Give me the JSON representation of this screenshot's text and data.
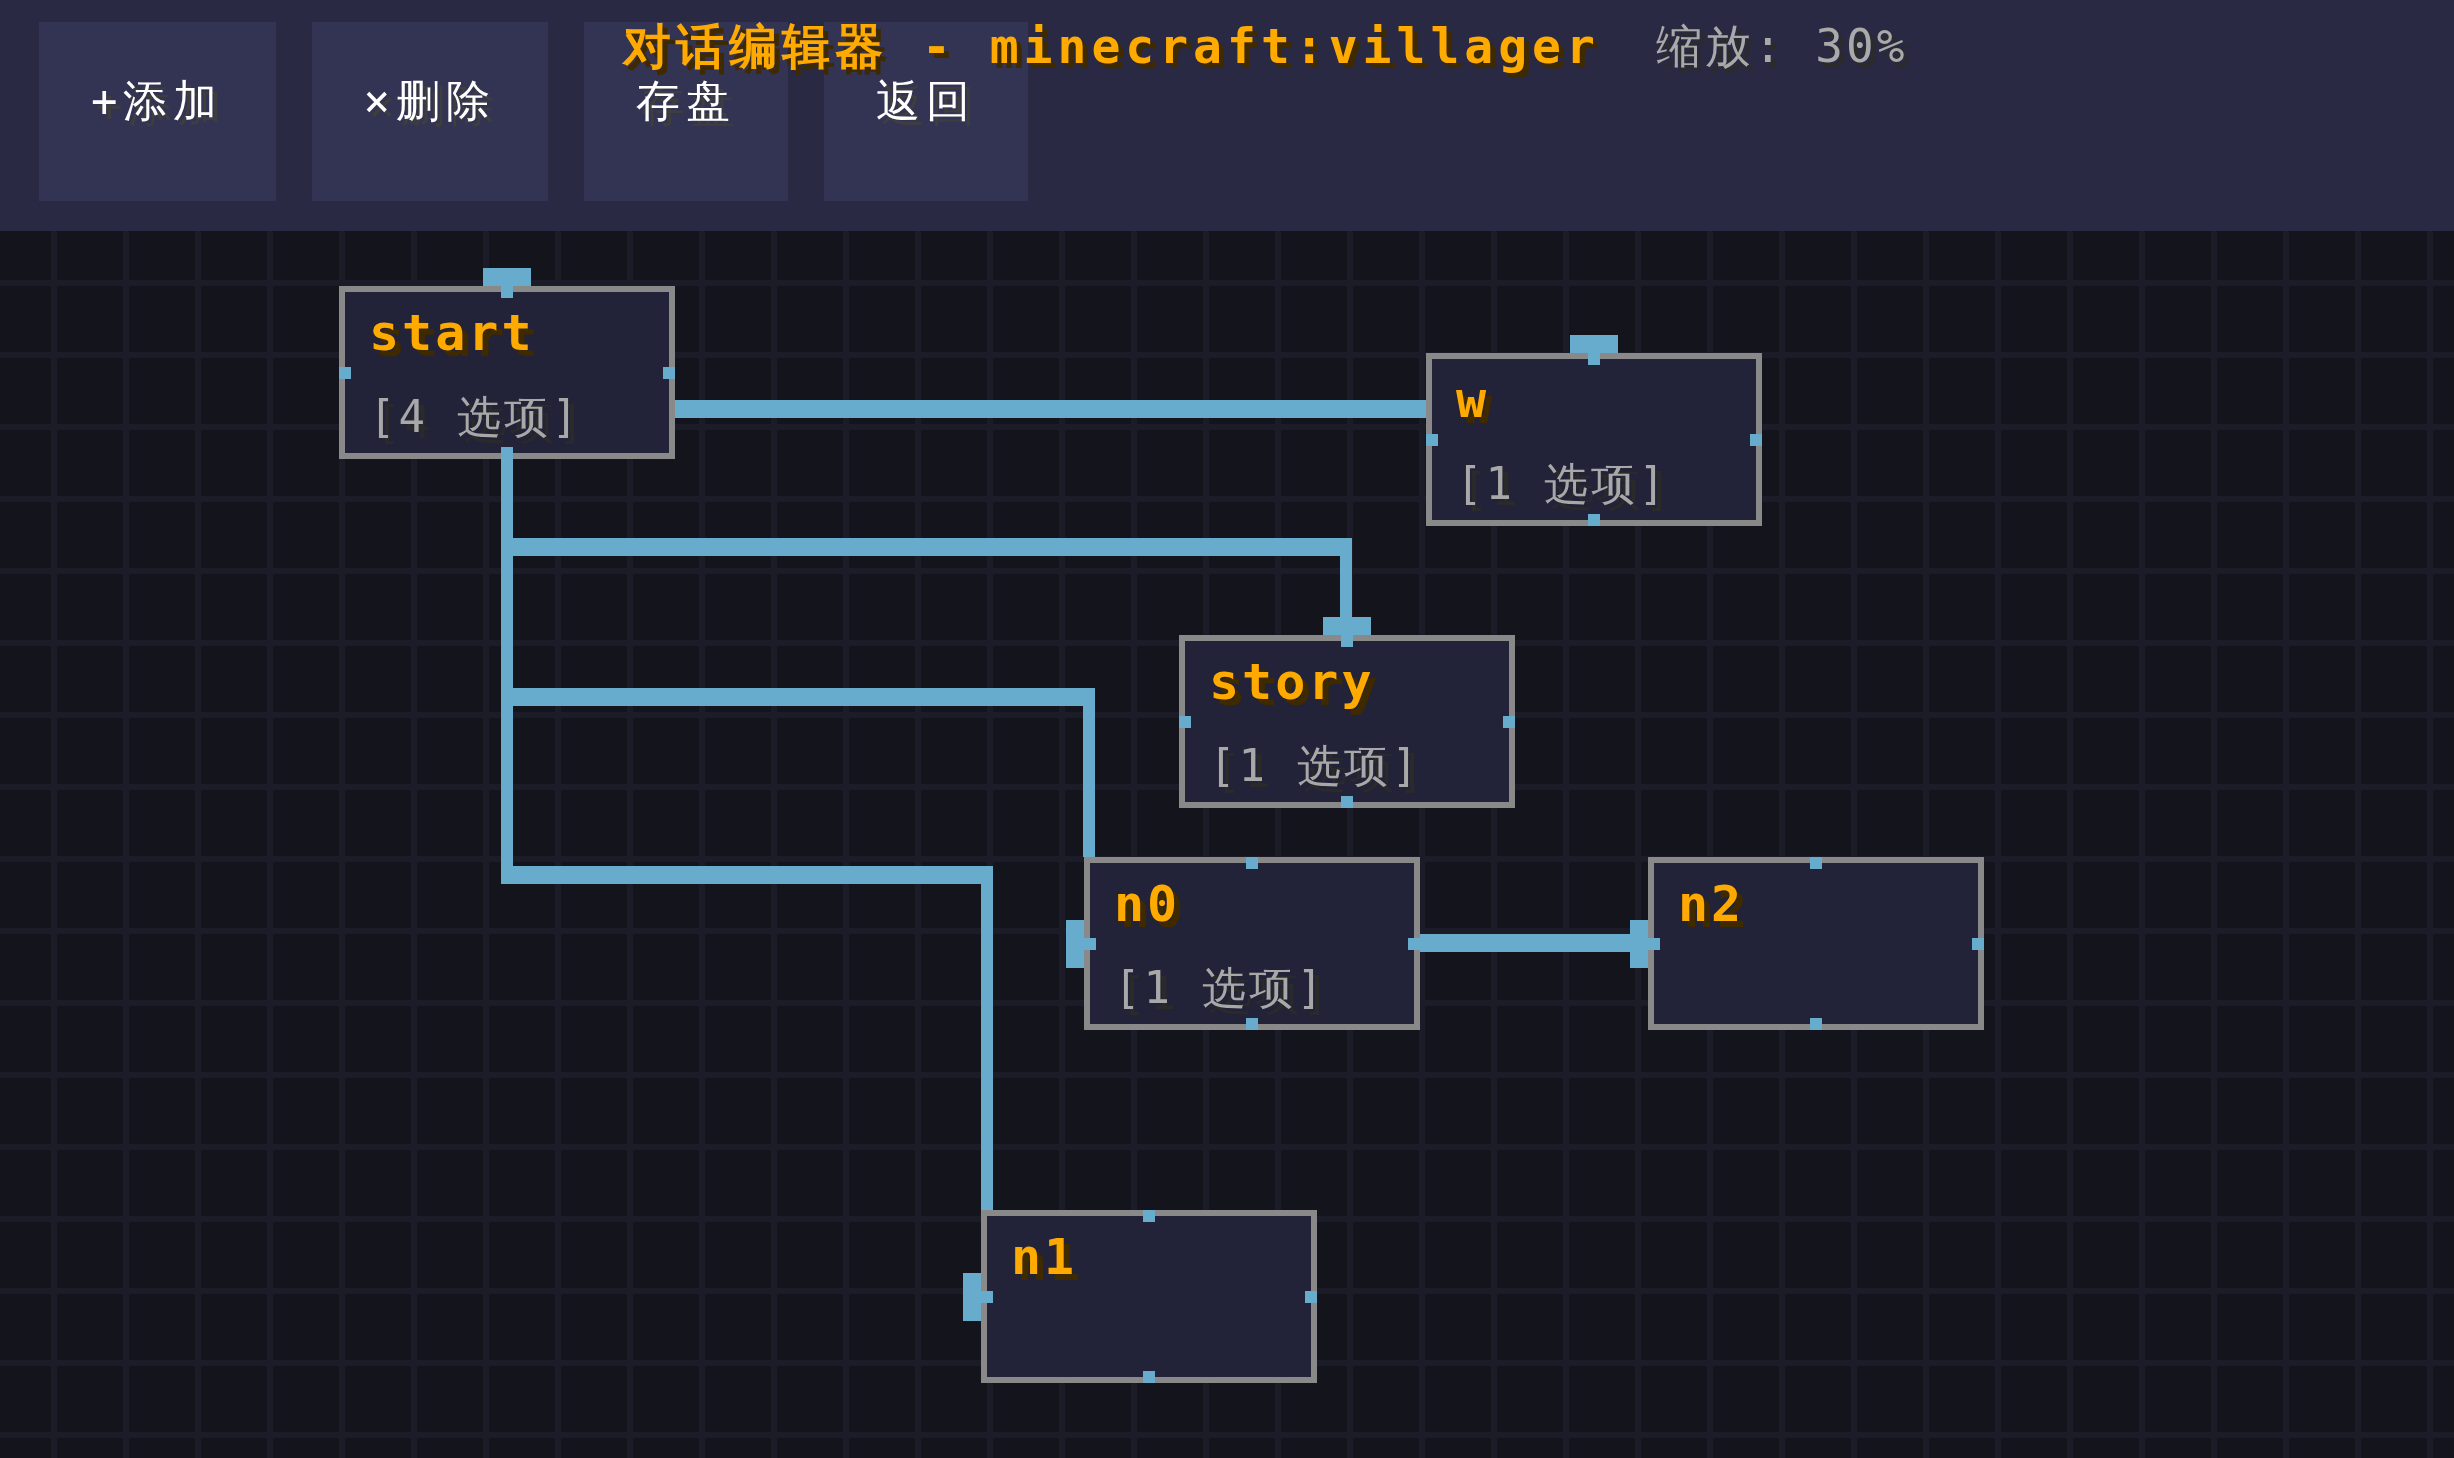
{
  "toolbar": {
    "buttons": [
      "+添加",
      "×删除",
      "存盘",
      "返回"
    ],
    "title": "对话编辑器 - minecraft:villager",
    "zoom_label": "缩放: 30%"
  },
  "nodes": [
    {
      "name": "start",
      "options": "[4 选项]",
      "kind": "top",
      "children": [
        {
          "name": "w",
          "options": "[1 选项]",
          "kind": "top"
        },
        {
          "name": "story",
          "options": "[1 选项]",
          "kind": "top"
        },
        {
          "name": "n0",
          "options": "[1 选项]",
          "kind": "left",
          "children": [
            {
              "name": "n2",
              "kind": "left"
            }
          ]
        },
        {
          "name": "n1",
          "kind": "left"
        }
      ]
    }
  ]
}
